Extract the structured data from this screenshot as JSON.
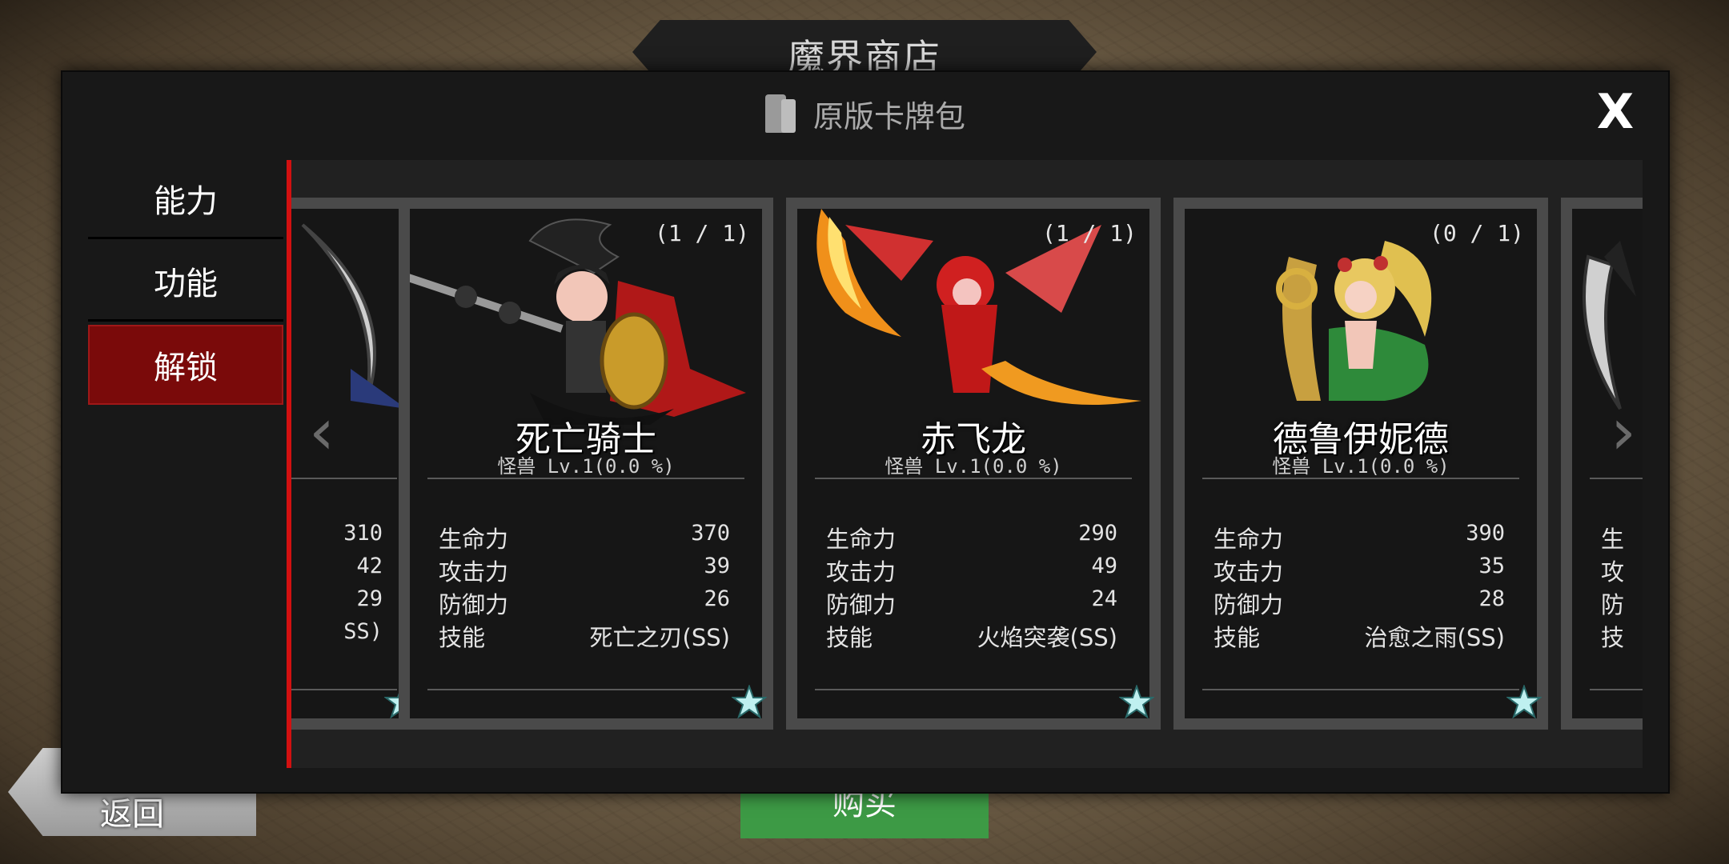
{
  "shop_title": "魔界商店",
  "back_label": "返回",
  "buy_label": "购买",
  "modal": {
    "title": "原版卡牌包",
    "close": "X"
  },
  "sidebar": {
    "items": [
      {
        "label": "能力"
      },
      {
        "label": "功能"
      },
      {
        "label": "解锁"
      }
    ]
  },
  "arrows": {
    "left": "‹",
    "right": "›"
  },
  "partial_left_card": {
    "values": [
      "310",
      "42",
      "29",
      "SS)"
    ]
  },
  "partial_right_card": {
    "labels": [
      "生",
      "攻",
      "防",
      "技"
    ]
  },
  "cards": [
    {
      "count": "(1 / 1)",
      "name": "死亡骑士",
      "type": "怪兽 Lv.1(0.0 %)",
      "stats": [
        {
          "label": "生命力",
          "value": "370"
        },
        {
          "label": "攻击力",
          "value": "39"
        },
        {
          "label": "防御力",
          "value": "26"
        },
        {
          "label": "技能",
          "value": "死亡之刃(SS)"
        }
      ]
    },
    {
      "count": "(1 / 1)",
      "name": "赤飞龙",
      "type": "怪兽 Lv.1(0.0 %)",
      "stats": [
        {
          "label": "生命力",
          "value": "290"
        },
        {
          "label": "攻击力",
          "value": "49"
        },
        {
          "label": "防御力",
          "value": "24"
        },
        {
          "label": "技能",
          "value": "火焰突袭(SS)"
        }
      ]
    },
    {
      "count": "(0 / 1)",
      "name": "德鲁伊妮德",
      "type": "怪兽 Lv.1(0.0 %)",
      "stats": [
        {
          "label": "生命力",
          "value": "390"
        },
        {
          "label": "攻击力",
          "value": "35"
        },
        {
          "label": "防御力",
          "value": "28"
        },
        {
          "label": "技能",
          "value": "治愈之雨(SS)"
        }
      ]
    }
  ],
  "colors": {
    "accent_red": "#d21010",
    "active_tab": "#7a0a0a",
    "buy_green": "#3d9a45"
  }
}
